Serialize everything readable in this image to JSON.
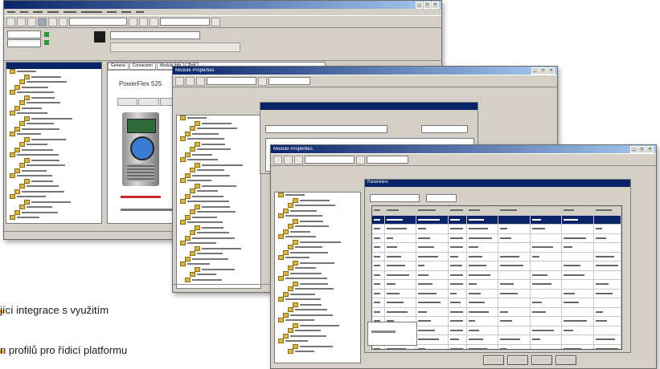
{
  "captions": {
    "line1": "jící integrace s využitím",
    "line2": "n profilů pro řídicí platformu"
  },
  "window1": {
    "title": "",
    "product_name": "PowerFlex 525",
    "tabs": [
      "General",
      "Connection",
      "Module Info",
      "Port"
    ]
  },
  "window2": {
    "title": "Module Properties"
  },
  "window3": {
    "title": "Module Properties",
    "dialog_title": "Parameters"
  },
  "colors": {
    "titlebar": "#0a246a",
    "selection": "#0a246a",
    "drive_red": "#c62828",
    "folder": "#d8b64a"
  }
}
